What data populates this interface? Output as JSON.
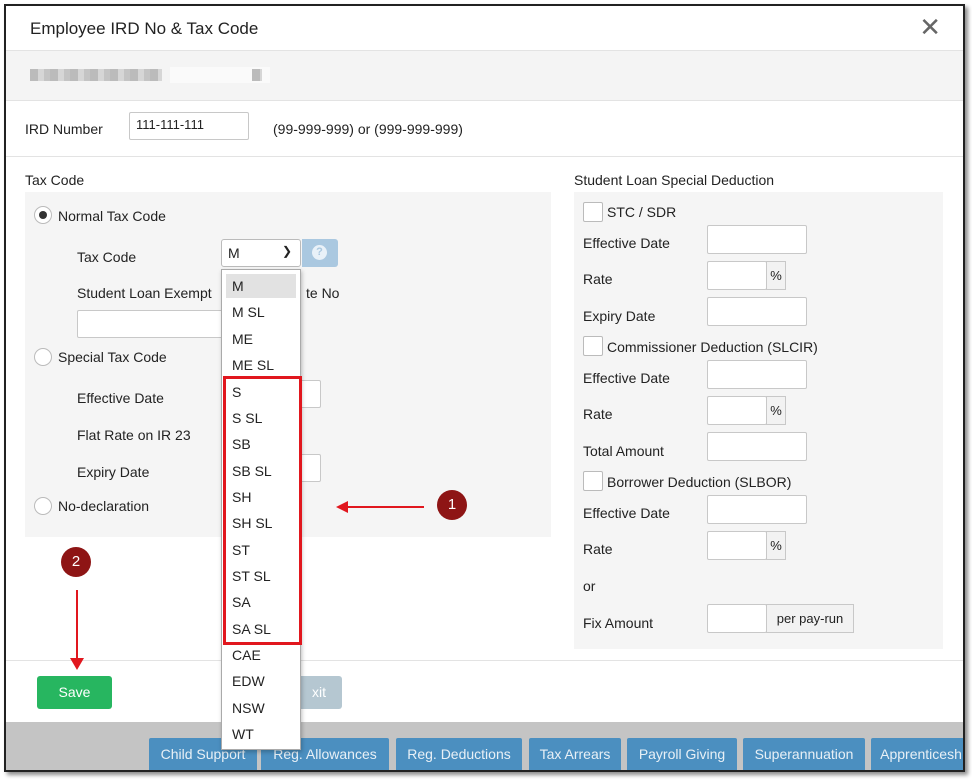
{
  "dialog": {
    "title": "Employee IRD No & Tax Code",
    "close_icon": "close-icon"
  },
  "ird": {
    "label": "IRD Number",
    "value": "111-111-111",
    "hint": "(99-999-999) or (999-999-999)"
  },
  "tax_code_section": {
    "heading": "Tax Code",
    "normal_label": "Normal Tax Code",
    "tax_code_label": "Tax Code",
    "tax_code_value": "M",
    "student_loan_label": "Student Loan Exempt",
    "student_loan_label_tail": "te No",
    "special_label": "Special Tax Code",
    "effective_date_label": "Effective Date",
    "flat_rate_label": "Flat Rate on IR 23",
    "expiry_date_label": "Expiry Date",
    "no_declaration_label": "No-declaration"
  },
  "dropdown_options": [
    "M",
    "M SL",
    "ME",
    "ME SL",
    "S",
    "S SL",
    "SB",
    "SB SL",
    "SH",
    "SH SL",
    "ST",
    "ST SL",
    "SA",
    "SA SL",
    "CAE",
    "EDW",
    "NSW",
    "WT"
  ],
  "student_loan_deduction": {
    "heading": "Student Loan Special Deduction",
    "stc_label": "STC / SDR",
    "effective_date_label": "Effective Date",
    "rate_label": "Rate",
    "expiry_date_label": "Expiry Date",
    "commissioner_label": "Commissioner Deduction (SLCIR)",
    "total_amount_label": "Total Amount",
    "borrower_label": "Borrower Deduction (SLBOR)",
    "or_label": "or",
    "fix_amount_label": "Fix Amount",
    "percent": "%",
    "per_pay_run": "per pay-run"
  },
  "footer": {
    "save": "Save",
    "exit": "Exit",
    "exit_visible": "xit"
  },
  "bottom_tabs": [
    "Child Support",
    "Reg. Allowances",
    "Reg. Deductions",
    "Tax Arrears",
    "Payroll Giving",
    "Superannuation",
    "Apprenticesh"
  ],
  "annotations": {
    "badge_1": "1",
    "badge_2": "2"
  },
  "colors": {
    "save_green": "#27b660",
    "annotation_red": "#e1171e",
    "badge_dark_red": "#8e1515",
    "tab_blue": "#4b8fc0"
  }
}
